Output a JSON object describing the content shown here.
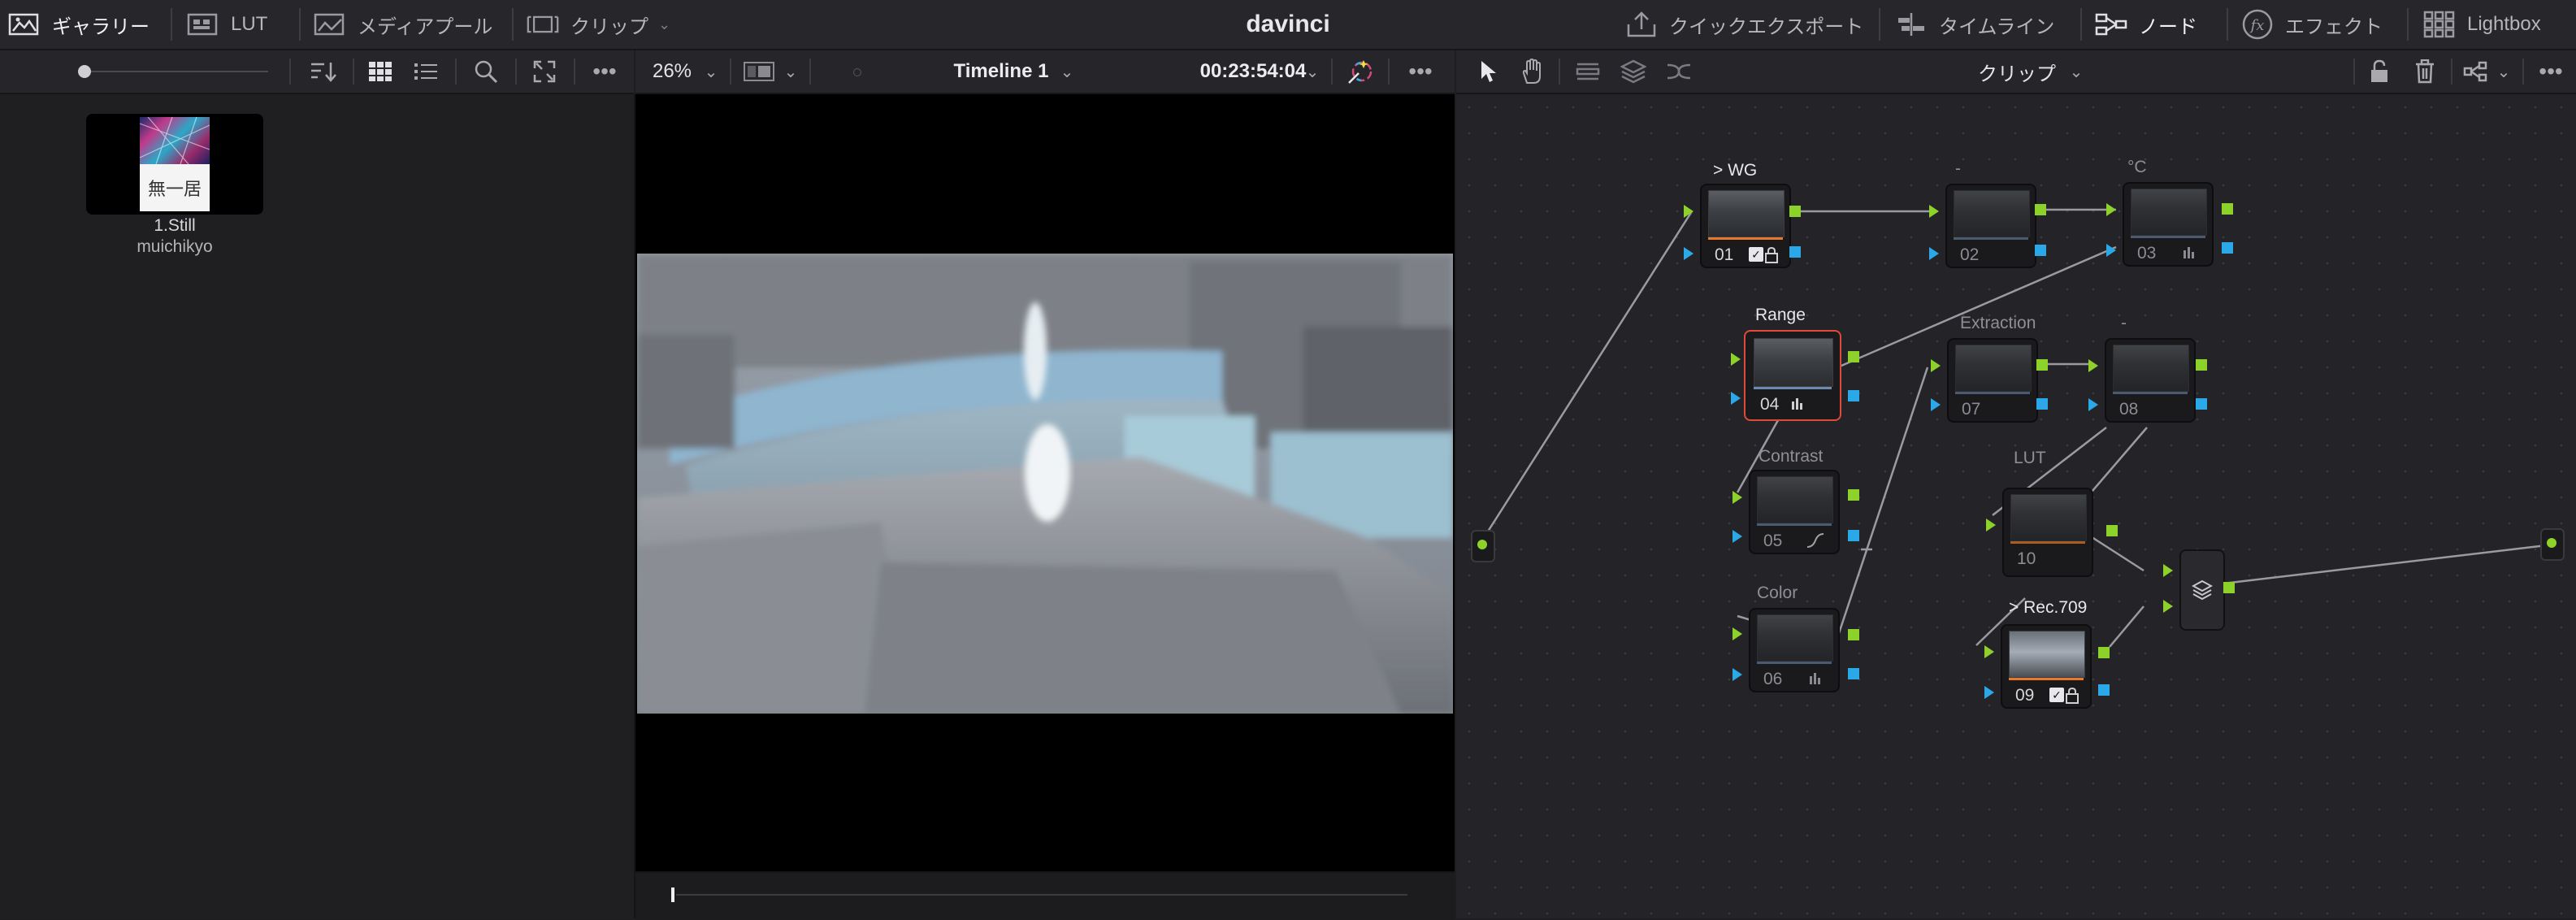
{
  "app_title": "davinci",
  "top_nav": {
    "gallery": "ギャラリー",
    "lut": "LUT",
    "media_pool": "メディアプール",
    "clips": "クリップ",
    "quick_export": "クイックエクスポート",
    "timeline": "タイムライン",
    "nodes": "ノード",
    "effects": "エフェクト",
    "lightbox": "Lightbox"
  },
  "viewer_bar": {
    "zoom": "26%",
    "timeline_name": "Timeline 1",
    "timecode": "00:23:54:04"
  },
  "node_bar": {
    "mode": "クリップ"
  },
  "gallery": {
    "stills": [
      {
        "title": "1.Still",
        "subtitle": "muichikyo",
        "thumb_text": "無一居"
      }
    ]
  },
  "nodes": [
    {
      "id": "01",
      "label": "> WG",
      "active": true
    },
    {
      "id": "02",
      "label": "-",
      "active": false
    },
    {
      "id": "03",
      "label": "°C",
      "active": false
    },
    {
      "id": "04",
      "label": "Range",
      "active": true
    },
    {
      "id": "05",
      "label": "Contrast",
      "active": false
    },
    {
      "id": "06",
      "label": "Color",
      "active": false
    },
    {
      "id": "07",
      "label": "Extraction",
      "active": false
    },
    {
      "id": "08",
      "label": "-",
      "active": false
    },
    {
      "id": "10",
      "label": "LUT",
      "active": false
    },
    {
      "id": "09",
      "label": "> Rec.709",
      "active": true
    }
  ],
  "colors": {
    "accent_green": "#8cd22a",
    "accent_blue": "#2aa8e8",
    "selected_red": "#e04a3a",
    "orange": "#e67a2a"
  }
}
